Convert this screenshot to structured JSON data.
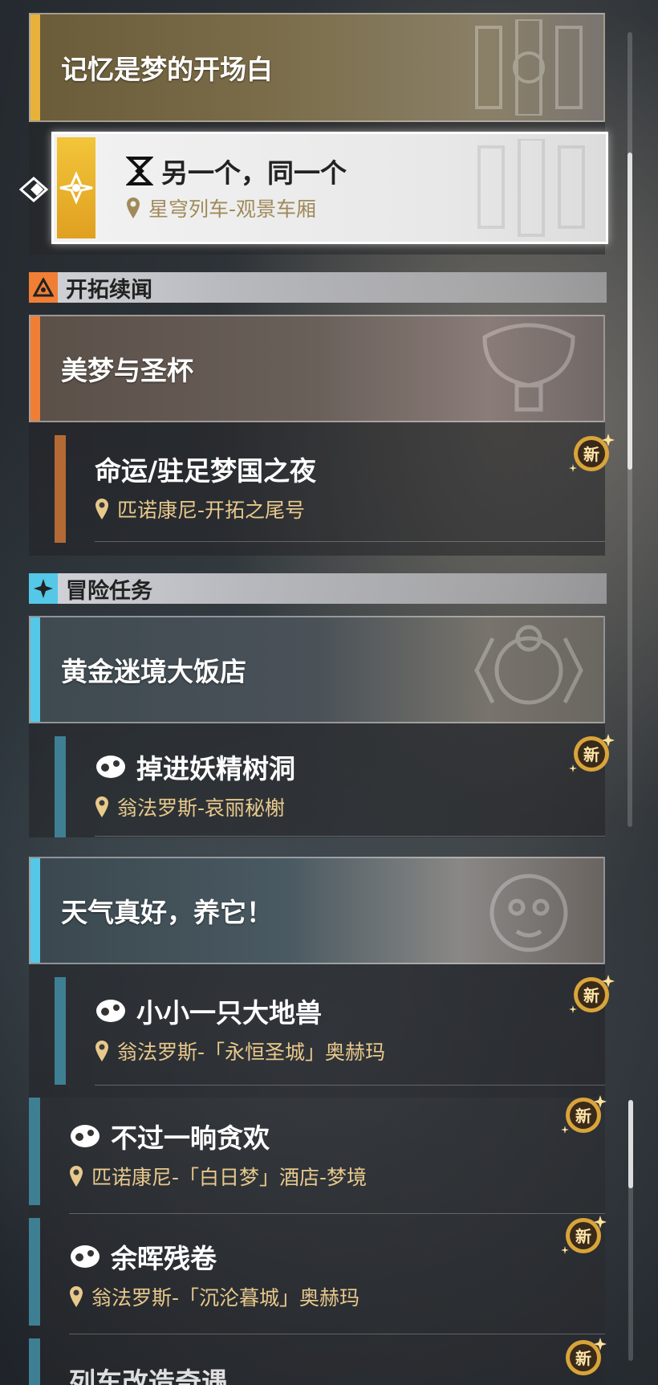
{
  "active_series": {
    "title": "记忆是梦的开场白",
    "accent": "#e8b23a",
    "selected_quest": {
      "name": "另一个，同一个",
      "location": "星穹列车-观景车厢"
    }
  },
  "groups": [
    {
      "label": "开拓续闻",
      "accent": "#f07f35",
      "icon": "trailblaze-triangle-icon",
      "series": [
        {
          "title": "美梦与圣杯",
          "quests": [
            {
              "name": "命运/驻足梦国之夜",
              "location": "匹诺康尼-开拓之尾号",
              "badge": "新"
            }
          ]
        }
      ]
    },
    {
      "label": "冒险任务",
      "accent": "#55c8e8",
      "icon": "adventure-star-icon",
      "series": [
        {
          "title": "黄金迷境大饭店",
          "quests": [
            {
              "name": "掉进妖精树洞",
              "location": "翁法罗斯-哀丽秘榭",
              "badge": "新"
            }
          ]
        },
        {
          "title": "天气真好，养它！",
          "quests": [
            {
              "name": "小小一只大地兽",
              "location": "翁法罗斯-「永恒圣城」奥赫玛",
              "badge": "新"
            },
            {
              "name": "不过一晌贪欢",
              "location": "匹诺康尼-「白日梦」酒店-梦境",
              "badge": "新"
            },
            {
              "name": "余晖残卷",
              "location": "翁法罗斯-「沉沦暮城」奥赫玛",
              "badge": "新"
            },
            {
              "name": "列车改造奇遇",
              "location": "",
              "badge": "新"
            }
          ]
        }
      ]
    }
  ],
  "colors": {
    "location_text": "#e8c98c",
    "badge_gold": "#d9a43a",
    "quest_bar_orange": "#b46a35",
    "quest_bar_blue": "#3f7f93"
  }
}
